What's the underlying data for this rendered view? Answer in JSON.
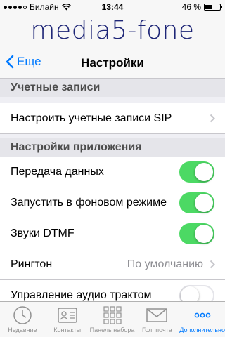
{
  "status": {
    "carrier": "Билайн",
    "time": "13:44",
    "battery_text": "46 %",
    "battery_level": 0.46
  },
  "brand": {
    "logo_text": "media5-fone"
  },
  "nav": {
    "back_label": "Еще",
    "title": "Настройки"
  },
  "sections": {
    "accounts": {
      "header": "Учетные записи",
      "sip_label": "Настроить учетные записи SIP"
    },
    "app": {
      "header": "Настройки приложения",
      "data_label": "Передача данных",
      "data_on": true,
      "background_label": "Запустить в фоновом режиме",
      "background_on": true,
      "dtmf_label": "Звуки DTMF",
      "dtmf_on": true,
      "ringtone_label": "Рингтон",
      "ringtone_value": "По умолчанию",
      "audio_label": "Управление аудио трактом",
      "audio_on": false
    }
  },
  "tabs": [
    {
      "label": "Недавние",
      "icon": "clock-icon",
      "active": false
    },
    {
      "label": "Контакты",
      "icon": "contacts-card-icon",
      "active": false
    },
    {
      "label": "Панель набора",
      "icon": "keypad-icon",
      "active": false
    },
    {
      "label": "Гол. почта",
      "icon": "voicemail-envelope-icon",
      "active": false
    },
    {
      "label": "Дополнительно",
      "icon": "more-dots-icon",
      "active": true
    }
  ],
  "colors": {
    "accent": "#007aff",
    "toggle_on": "#4cd964",
    "brand_text": "#1e2677"
  }
}
